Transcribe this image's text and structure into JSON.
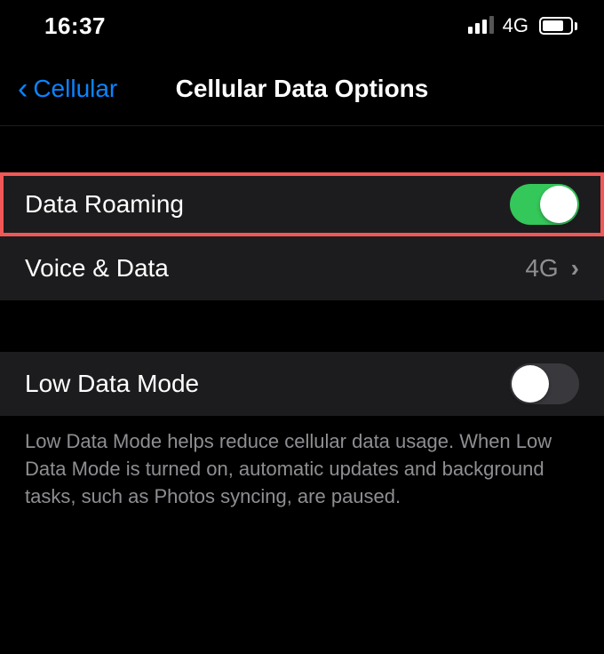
{
  "statusBar": {
    "time": "16:37",
    "networkLabel": "4G"
  },
  "nav": {
    "backLabel": "Cellular",
    "title": "Cellular Data Options"
  },
  "rows": {
    "dataRoaming": {
      "label": "Data Roaming",
      "toggleOn": true
    },
    "voiceData": {
      "label": "Voice & Data",
      "value": "4G"
    },
    "lowDataMode": {
      "label": "Low Data Mode",
      "toggleOn": false
    }
  },
  "footer": {
    "lowDataModeHelp": "Low Data Mode helps reduce cellular data usage. When Low Data Mode is turned on, automatic updates and background tasks, such as Photos syncing, are paused."
  },
  "highlight": {
    "row": "data-roaming-row",
    "color": "#f25757"
  }
}
